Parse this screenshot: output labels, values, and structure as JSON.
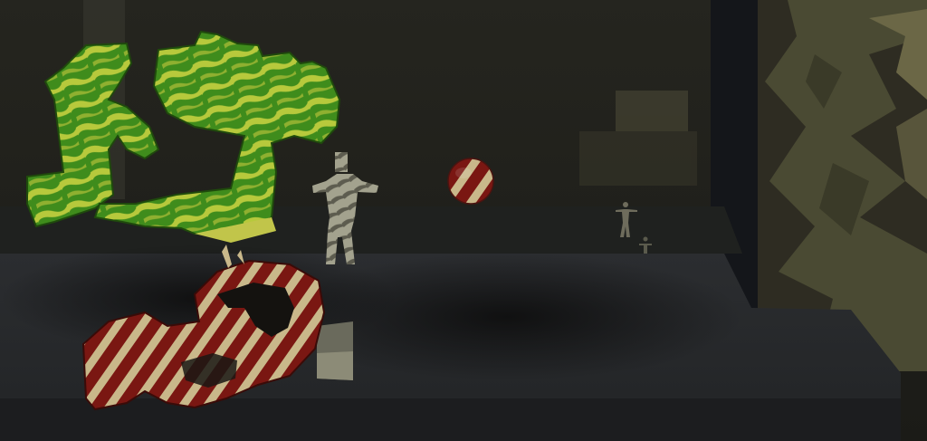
{
  "scene": {
    "kind": "3d-render",
    "lighting": "dim",
    "palette": {
      "background": "#1c1c17",
      "back_wall": "#23231d",
      "window_right": "#2e2c22",
      "window_foliage": "#4a4a33",
      "window_highlight": "#6b6746",
      "dark_window": "#14161a",
      "floor_far": "#202220",
      "floor_near": "#2a2c2e",
      "ledge_front": "#1c1d1f",
      "green_primary": "#3f8c1c",
      "green_highlight": "#b7c93c",
      "stripe_red": "#7a1712",
      "stripe_cream": "#c9b88a",
      "figure_light": "#a3a28e",
      "figure_dark": "#5d5c4f"
    },
    "objects": [
      {
        "name": "green-figure-left",
        "material": "green-camouflage"
      },
      {
        "name": "green-block-shape",
        "material": "green-camouflage"
      },
      {
        "name": "striped-ribbon-loop",
        "material": "red-cream-stripes"
      },
      {
        "name": "humanoid-figure-large",
        "material": "gray-camouflage"
      },
      {
        "name": "humanoid-figure-small",
        "material": "gray"
      },
      {
        "name": "humanoid-figure-tiny",
        "material": "gray"
      },
      {
        "name": "striped-sphere",
        "material": "red-cream-stripes"
      }
    ]
  }
}
